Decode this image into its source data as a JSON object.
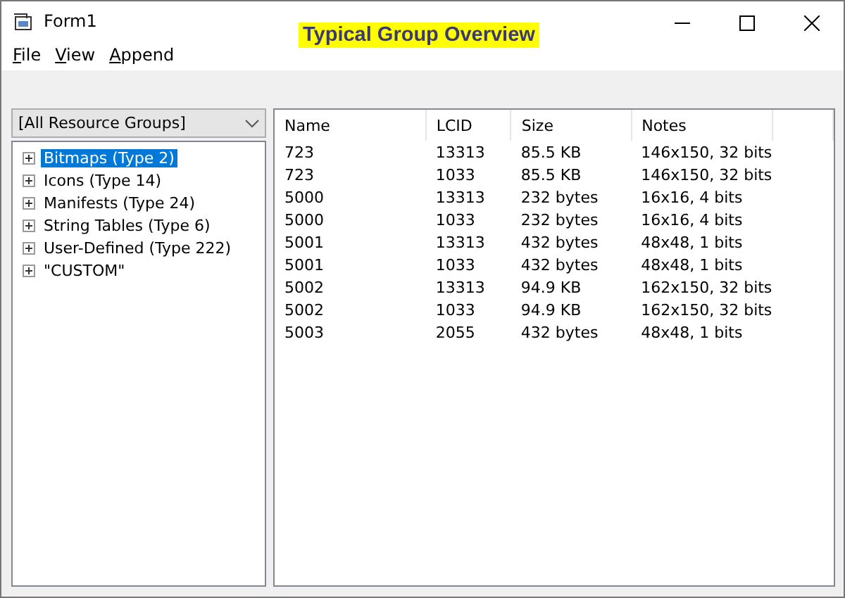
{
  "window": {
    "title": "Form1",
    "banner": "Typical Group Overview"
  },
  "menu": [
    "File",
    "View",
    "Append"
  ],
  "group_select": {
    "value": "[All Resource Groups]"
  },
  "tree": [
    {
      "label": "Bitmaps (Type 2)",
      "selected": true
    },
    {
      "label": "Icons (Type 14)",
      "selected": false
    },
    {
      "label": "Manifests (Type 24)",
      "selected": false
    },
    {
      "label": "String Tables (Type 6)",
      "selected": false
    },
    {
      "label": "User-Defined (Type 222)",
      "selected": false
    },
    {
      "label": "\"CUSTOM\"",
      "selected": false
    }
  ],
  "table": {
    "columns": [
      "Name",
      "LCID",
      "Size",
      "Notes"
    ],
    "rows": [
      [
        "723",
        "13313",
        "85.5 KB",
        "146x150, 32 bits"
      ],
      [
        "723",
        "1033",
        "85.5 KB",
        "146x150, 32 bits"
      ],
      [
        "5000",
        "13313",
        "232 bytes",
        "16x16, 4 bits"
      ],
      [
        "5000",
        "1033",
        "232 bytes",
        "16x16, 4 bits"
      ],
      [
        "5001",
        "13313",
        "432 bytes",
        "48x48, 1 bits"
      ],
      [
        "5001",
        "1033",
        "432 bytes",
        "48x48, 1 bits"
      ],
      [
        "5002",
        "13313",
        "94.9 KB",
        "162x150, 32 bits"
      ],
      [
        "5002",
        "1033",
        "94.9 KB",
        "162x150, 32 bits"
      ],
      [
        "5003",
        "2055",
        "432 bytes",
        "48x48, 1 bits"
      ]
    ]
  }
}
